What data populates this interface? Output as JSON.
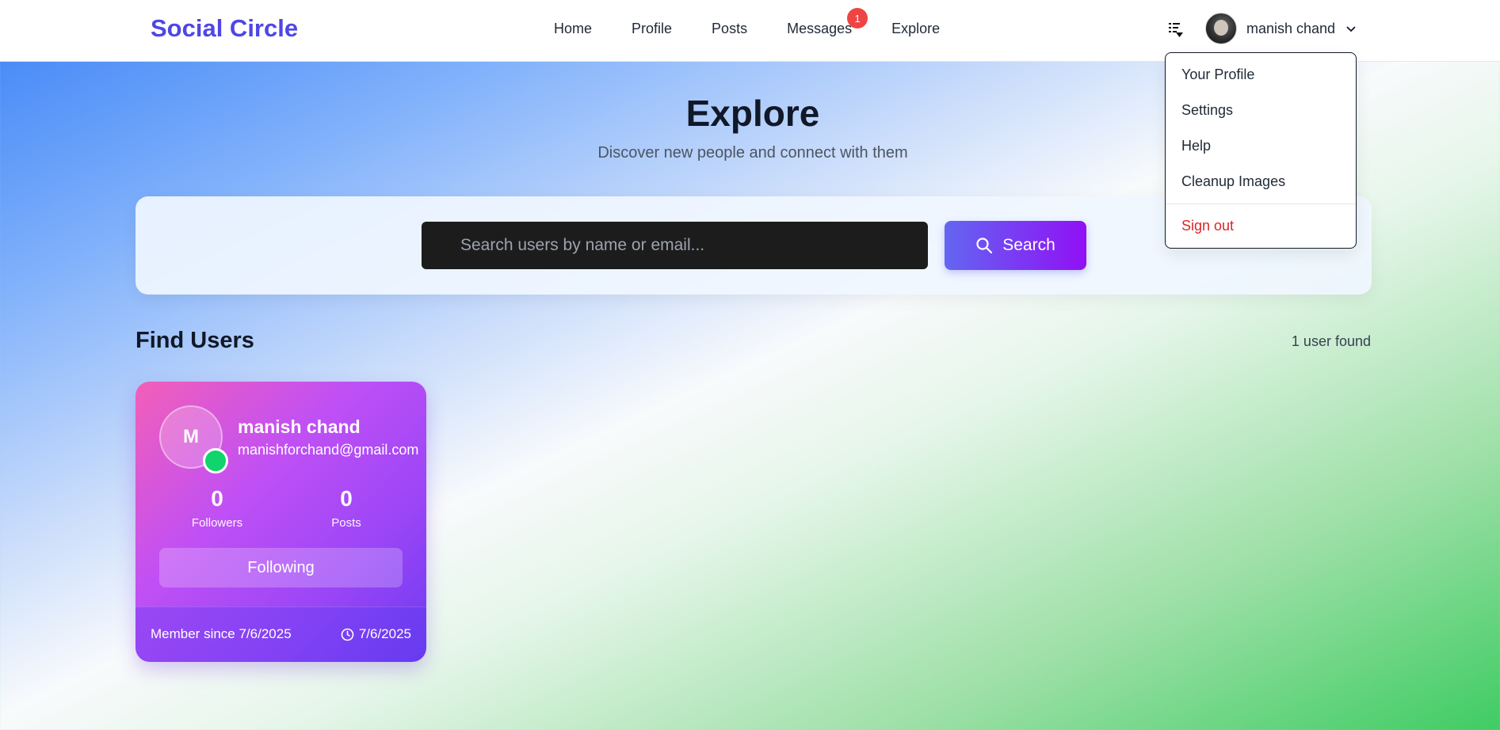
{
  "navbar": {
    "brand": "Social Circle",
    "links": [
      "Home",
      "Profile",
      "Posts",
      "Messages",
      "Explore"
    ],
    "messages_badge": "1",
    "user_name": "manish chand",
    "icons": {
      "tool": "text-direction-icon",
      "chevron": "chevron-down-icon"
    }
  },
  "dropdown": {
    "items": [
      "Your Profile",
      "Settings",
      "Help",
      "Cleanup Images"
    ],
    "signout": "Sign out"
  },
  "header": {
    "title": "Explore",
    "subtitle": "Discover new people and connect with them"
  },
  "search": {
    "placeholder": "Search users by name or email...",
    "value": "",
    "button_label": "Search"
  },
  "results": {
    "title": "Find Users",
    "count": "1 user found"
  },
  "user_card": {
    "initial": "M",
    "name": "manish chand",
    "email": "manishforchand@gmail.com",
    "followers_value": "0",
    "followers_label": "Followers",
    "posts_value": "0",
    "posts_label": "Posts",
    "follow_button": "Following",
    "member_since": "Member since 7/6/2025",
    "last_active": "7/6/2025"
  },
  "colors": {
    "brand": "#4f46e5",
    "badge": "#ef4444",
    "signout": "#dc2626",
    "online": "#10d46c"
  }
}
